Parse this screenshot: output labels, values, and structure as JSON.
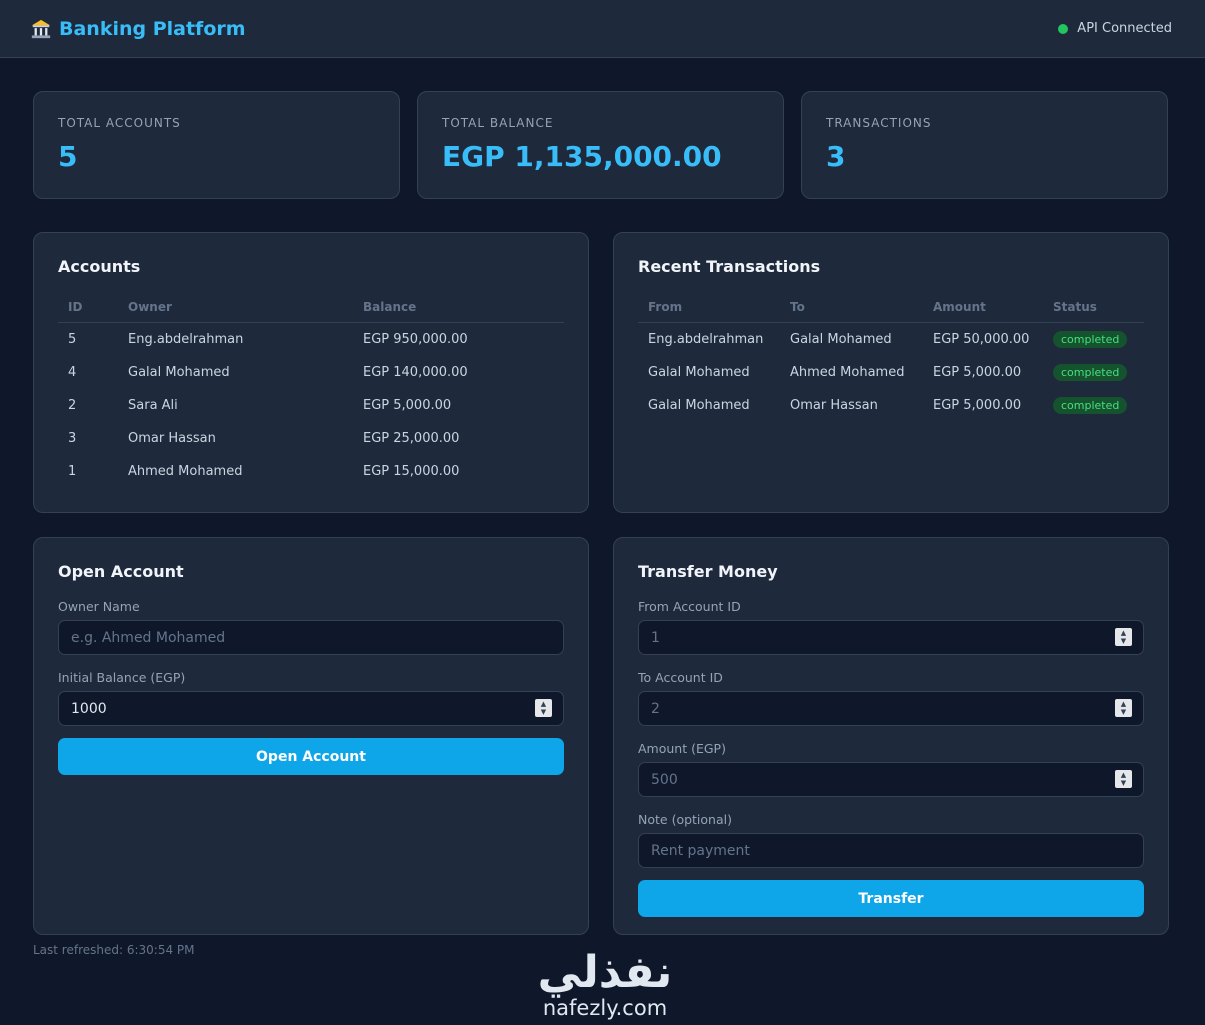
{
  "header": {
    "title": "Banking Platform",
    "icon": "bank-icon",
    "api_status": "API Connected",
    "status_color": "#22c55e"
  },
  "stats": [
    {
      "label": "TOTAL ACCOUNTS",
      "value": "5"
    },
    {
      "label": "TOTAL BALANCE",
      "value": "EGP 1,135,000.00"
    },
    {
      "label": "TRANSACTIONS",
      "value": "3"
    }
  ],
  "accounts": {
    "title": "Accounts",
    "columns": [
      "ID",
      "Owner",
      "Balance"
    ],
    "rows": [
      [
        "5",
        "Eng.abdelrahman",
        "EGP 950,000.00"
      ],
      [
        "4",
        "Galal Mohamed",
        "EGP 140,000.00"
      ],
      [
        "2",
        "Sara Ali",
        "EGP 5,000.00"
      ],
      [
        "3",
        "Omar Hassan",
        "EGP 25,000.00"
      ],
      [
        "1",
        "Ahmed Mohamed",
        "EGP 15,000.00"
      ]
    ]
  },
  "transactions": {
    "title": "Recent Transactions",
    "columns": [
      "From",
      "To",
      "Amount",
      "Status"
    ],
    "rows": [
      [
        "Eng.abdelrahman",
        "Galal Mohamed",
        "EGP 50,000.00",
        "completed"
      ],
      [
        "Galal Mohamed",
        "Ahmed Mohamed",
        "EGP 5,000.00",
        "completed"
      ],
      [
        "Galal Mohamed",
        "Omar Hassan",
        "EGP 5,000.00",
        "completed"
      ]
    ]
  },
  "open_account": {
    "title": "Open Account",
    "owner_label": "Owner Name",
    "owner_placeholder": "e.g. Ahmed Mohamed",
    "balance_label": "Initial Balance (EGP)",
    "balance_value": "1000",
    "button": "Open Account"
  },
  "transfer": {
    "title": "Transfer Money",
    "from_label": "From Account ID",
    "from_placeholder": "1",
    "to_label": "To Account ID",
    "to_placeholder": "2",
    "amount_label": "Amount (EGP)",
    "amount_placeholder": "500",
    "note_label": "Note (optional)",
    "note_placeholder": "Rent payment",
    "button": "Transfer"
  },
  "footer": {
    "last_refreshed": "Last refreshed: 6:30:54 PM"
  },
  "watermark": {
    "arabic": "نفذلي",
    "latin": "nafezly.com"
  },
  "colors": {
    "accent": "#38bdf8",
    "button": "#0ea5e9",
    "background": "#0f172a",
    "card": "#1e293b",
    "badge_bg": "#14532d",
    "badge_text": "#4ade80"
  }
}
